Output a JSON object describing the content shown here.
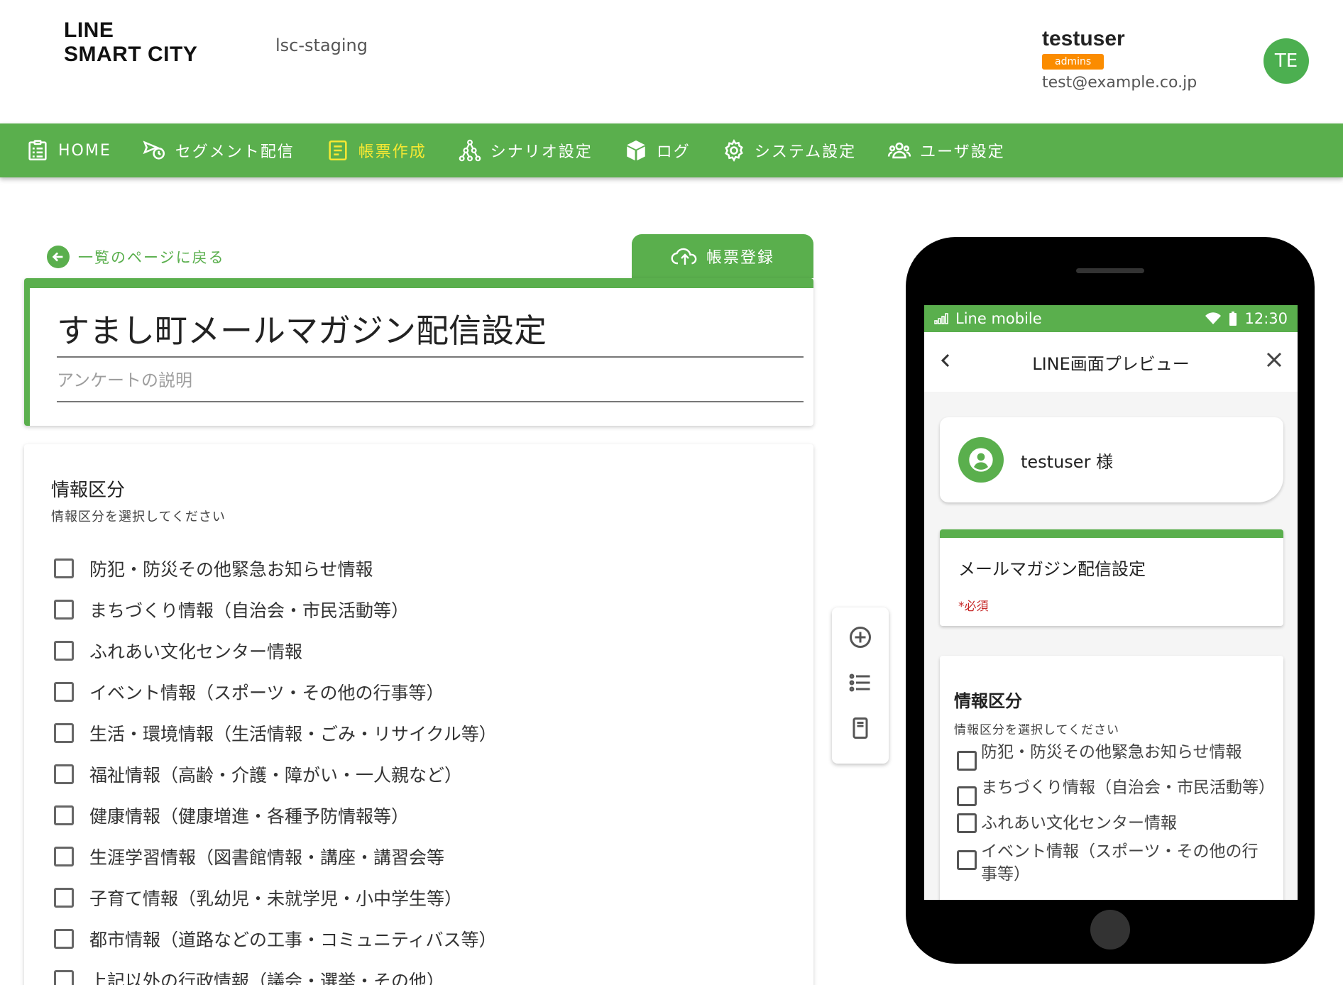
{
  "header": {
    "logo_line1": "LINE",
    "logo_line2": "SMART CITY",
    "environment": "lsc-staging",
    "user_name": "testuser",
    "user_role": "admins",
    "user_email": "test@example.co.jp",
    "avatar_initials": "TE"
  },
  "nav": {
    "items": [
      {
        "label": "HOME",
        "icon": "clipboard-icon"
      },
      {
        "label": "セグメント配信",
        "icon": "send-clock-icon"
      },
      {
        "label": "帳票作成",
        "icon": "form-icon",
        "active": true
      },
      {
        "label": "シナリオ設定",
        "icon": "graph-icon"
      },
      {
        "label": "ログ",
        "icon": "box-icon"
      },
      {
        "label": "システム設定",
        "icon": "gear-icon"
      },
      {
        "label": "ユーザ設定",
        "icon": "users-icon"
      }
    ],
    "active_color": "#f6e833",
    "bar_color": "#5aaf4d"
  },
  "editor": {
    "back_label": "一覧のページに戻る",
    "register_label": "帳票登録",
    "form_title": "すまし町メールマガジン配信設定",
    "description_placeholder": "アンケートの説明",
    "question": {
      "title": "情報区分",
      "subtitle": "情報区分を選択してください",
      "options": [
        "防犯・防災その他緊急お知らせ情報",
        "まちづくり情報（自治会・市民活動等）",
        "ふれあい文化センター情報",
        "イベント情報（スポーツ・その他の行事等）",
        "生活・環境情報（生活情報・ごみ・リサイクル等）",
        "福祉情報（高齢・介護・障がい・一人親など）",
        "健康情報（健康増進・各種予防情報等）",
        "生涯学習情報（図書館情報・講座・講習会等",
        "子育て情報（乳幼児・未就学児・小中学生等）",
        "都市情報（道路などの工事・コミュニティバス等）",
        "上記以外の行政情報（議会・選挙・その他）"
      ]
    }
  },
  "tools": [
    "add-circle-icon",
    "list-icon",
    "page-icon"
  ],
  "preview": {
    "carrier": "Line mobile",
    "time": "12:30",
    "title": "LINE画面プレビュー",
    "username": "testuser 様",
    "form_title": "メールマガジン配信設定",
    "required_label": "*必須",
    "question_title": "情報区分",
    "question_subtitle": "情報区分を選択してください",
    "options": [
      "防犯・防災その他緊急お知らせ情報",
      "まちづくり情報（自治会・市民活動等）",
      "ふれあい文化センター情報",
      "イベント情報（スポーツ・その他の行事等）"
    ]
  }
}
